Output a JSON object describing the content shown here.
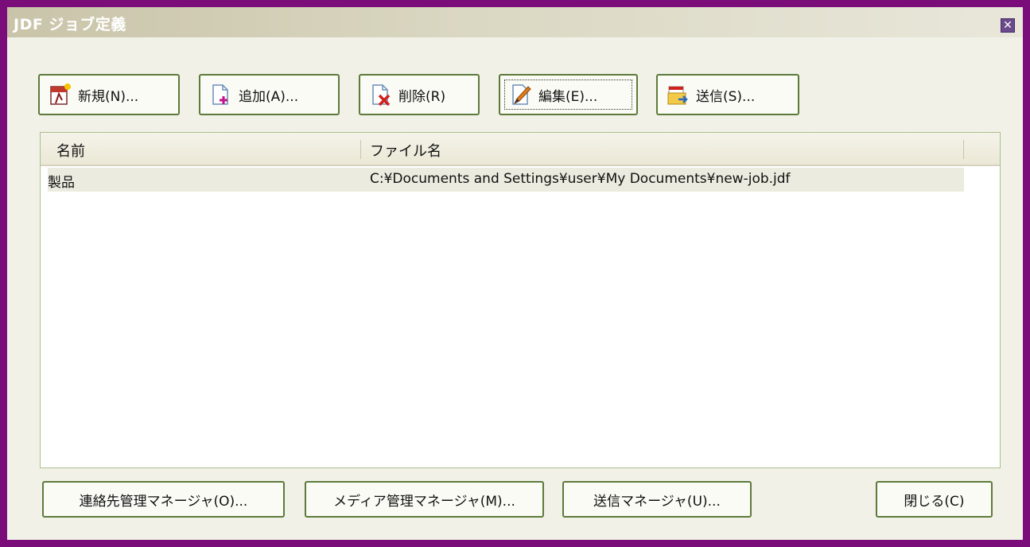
{
  "window": {
    "title": "JDF ジョブ定義"
  },
  "toolbar": [
    {
      "label": "新規(N)...",
      "icon": "new-jdf-icon"
    },
    {
      "label": "追加(A)...",
      "icon": "add-document-icon"
    },
    {
      "label": "削除(R)",
      "icon": "delete-document-icon"
    },
    {
      "label": "編集(E)...",
      "icon": "edit-pencil-icon"
    },
    {
      "label": "送信(S)...",
      "icon": "send-icon"
    }
  ],
  "list": {
    "columns": [
      "名前",
      "ファイル名"
    ],
    "rows": [
      {
        "name": "製品",
        "file": "C:¥Documents and Settings¥user¥My Documents¥new-job.jdf"
      }
    ]
  },
  "footer": {
    "contacts_manager": "連絡先管理マネージャ(O)...",
    "media_manager": "メディア管理マネージャ(M)...",
    "send_manager": "送信マネージャ(U)...",
    "close": "閉じる(C)"
  },
  "colors": {
    "frame": "#7b0d7b",
    "button_border": "#5d7a3a",
    "list_border": "#a9c08a"
  }
}
